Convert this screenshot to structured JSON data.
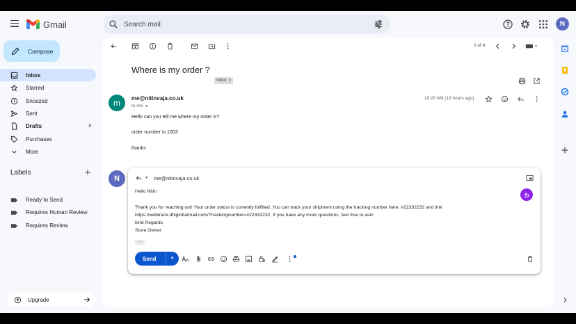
{
  "app": {
    "name": "Gmail",
    "colors": {
      "compose_bg": "#c2e7ff",
      "active_nav": "#d3e3fd",
      "send": "#0b57d0",
      "sender_avatar": "#00897b",
      "user_avatar": "#5c6bc0",
      "ai": "#8e24e8"
    }
  },
  "header": {
    "search_placeholder": "Search mail",
    "avatar_letter": "N"
  },
  "nav": {
    "compose_label": "Compose",
    "items": [
      {
        "label": "Inbox",
        "icon": "inbox-icon"
      },
      {
        "label": "Starred",
        "icon": "star-icon"
      },
      {
        "label": "Snoozed",
        "icon": "clock-icon"
      },
      {
        "label": "Sent",
        "icon": "send-icon"
      },
      {
        "label": "Drafts",
        "icon": "draft-icon",
        "count": "3"
      },
      {
        "label": "Purchases",
        "icon": "tag-icon"
      },
      {
        "label": "More",
        "icon": "chevron-down-icon"
      }
    ],
    "labels_title": "Labels",
    "labels": [
      {
        "label": "Ready to Send"
      },
      {
        "label": "Requires Human Review"
      },
      {
        "label": "Requires Review"
      }
    ],
    "upgrade_label": "Upgrade"
  },
  "thread": {
    "pager": "2 of 4",
    "subject": "Where is my order ?",
    "chip": "Inbox",
    "message": {
      "avatar_letter": "m",
      "sender": "me@nitinvaja.co.uk",
      "to": "to me",
      "time": "10:20 AM (13 hours ago)",
      "lines": [
        "Hello can you tell me where my order is?",
        "order number is 1003",
        "thanks"
      ]
    },
    "reply": {
      "avatar_letter": "N",
      "to": "me@nitinvaja.co.uk",
      "lines": [
        "Hello Nitin",
        "Thank you for reaching out! Your order status is currently fulfilled. You can track your shipment using the tracking number here: #22332232 and link",
        "https://webtrack.dhlglobalmail.com/?trackingnumber=#22332232. If you have any more questions, feel free to ask!",
        "kind Regards",
        "Store Owner"
      ],
      "send_label": "Send"
    }
  }
}
